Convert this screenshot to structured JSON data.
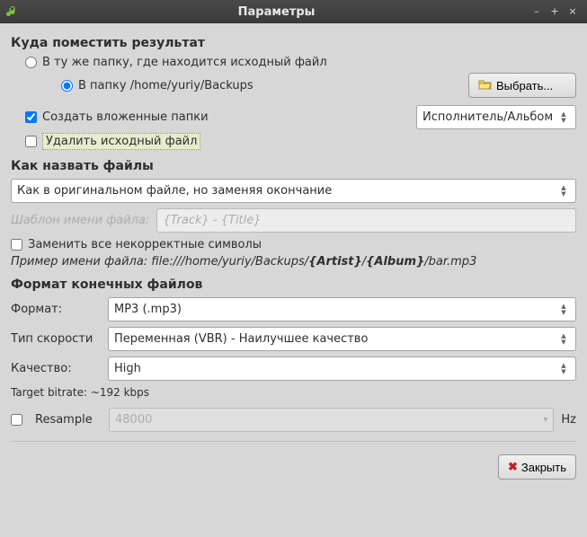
{
  "window": {
    "title": "Параметры"
  },
  "where": {
    "section": "Куда поместить результат",
    "same_folder": "В ту же папку, где находится исходный файл",
    "into_folder": "В папку /home/yuriy/Backups",
    "choose": "Выбрать...",
    "create_subfolders": "Создать вложенные папки",
    "subfolder_pattern": "Исполнитель/Альбом",
    "delete_original": "Удалить исходный файл"
  },
  "naming": {
    "section": "Как назвать файлы",
    "pattern_select": "Как в оригинальном файле, но заменяя окончание",
    "template_label": "Шаблон имени файла:",
    "template_placeholder": "{Track} - {Title}",
    "replace_bad": "Заменить все некорректные символы",
    "example_label": "Пример имени файла:",
    "example_value_prefix": "file:///home/yuriy/Backups/",
    "example_artist": "{Artist}",
    "example_sep": "/",
    "example_album": "{Album}",
    "example_suffix": "/bar.mp3"
  },
  "format": {
    "section": "Формат конечных файлов",
    "format_label": "Формат:",
    "format_value": "MP3   (.mp3)",
    "bitrate_type_label": "Тип скорости",
    "bitrate_type_value": "Переменная (VBR) - Наилучшее качество",
    "quality_label": "Качество:",
    "quality_value": "High",
    "target_bitrate": "Target bitrate: ~192 kbps",
    "resample_label": "Resample",
    "resample_value": "48000",
    "hz": "Hz"
  },
  "footer": {
    "close": "Закрыть"
  }
}
